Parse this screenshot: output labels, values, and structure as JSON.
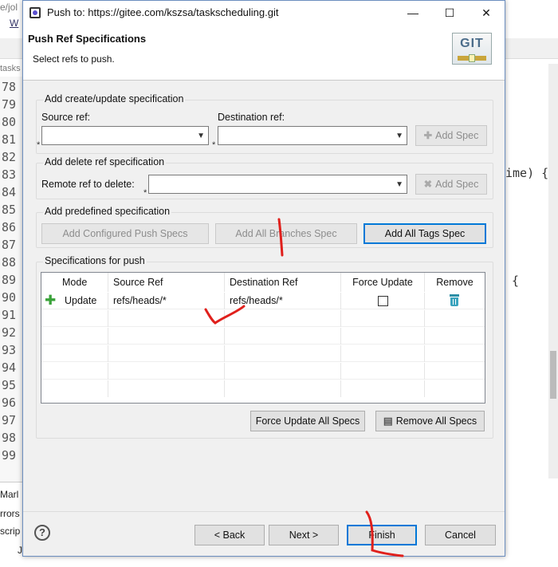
{
  "background": {
    "path_fragment": "e/jol",
    "w_link": "W",
    "tab_fragment": "tasks",
    "line_numbers": [
      "78",
      "79",
      "80",
      "81",
      "82",
      "83",
      "84",
      "85",
      "86",
      "87",
      "88",
      "89",
      "90",
      "91",
      "92",
      "93",
      "94",
      "95",
      "96",
      "97",
      "98",
      "99"
    ],
    "code_frag_1": "ime)  {",
    "code_frag_2": "{",
    "bottom_items": [
      "Marl",
      "rrors",
      "scrip",
      "J"
    ]
  },
  "dialog": {
    "title": "Push to: https://gitee.com/kszsa/taskscheduling.git",
    "window_controls": {
      "minimize": "—",
      "maximize": "☐",
      "close": "✕"
    },
    "header": {
      "title": "Push Ref Specifications",
      "subtitle": "Select refs to push.",
      "logo_text": "GIT"
    },
    "create_update": {
      "group_label": "Add create/update specification",
      "source_label": "Source ref:",
      "source_value": "",
      "destination_label": "Destination ref:",
      "destination_value": "",
      "add_spec_label": "Add Spec"
    },
    "delete_ref": {
      "group_label": "Add delete ref specification",
      "remote_label": "Remote ref to delete:",
      "remote_value": "",
      "add_spec_label": "Add Spec"
    },
    "predefined": {
      "group_label": "Add predefined specification",
      "configured_push_label": "Add Configured Push Specs",
      "all_branches_label": "Add All Branches Spec",
      "all_tags_label": "Add All Tags Spec"
    },
    "specs": {
      "group_label": "Specifications for push",
      "columns": [
        "Mode",
        "Source Ref",
        "Destination Ref",
        "Force Update",
        "Remove"
      ],
      "rows": [
        {
          "mode": "Update",
          "source": "refs/heads/*",
          "destination": "refs/heads/*",
          "force": false
        }
      ],
      "force_update_all_label": "Force Update All Specs",
      "remove_all_label": "Remove All Specs"
    },
    "footer": {
      "help": "?",
      "back_label": "< Back",
      "next_label": "Next >",
      "finish_label": "Finish",
      "cancel_label": "Cancel"
    },
    "required_marker": "*"
  }
}
